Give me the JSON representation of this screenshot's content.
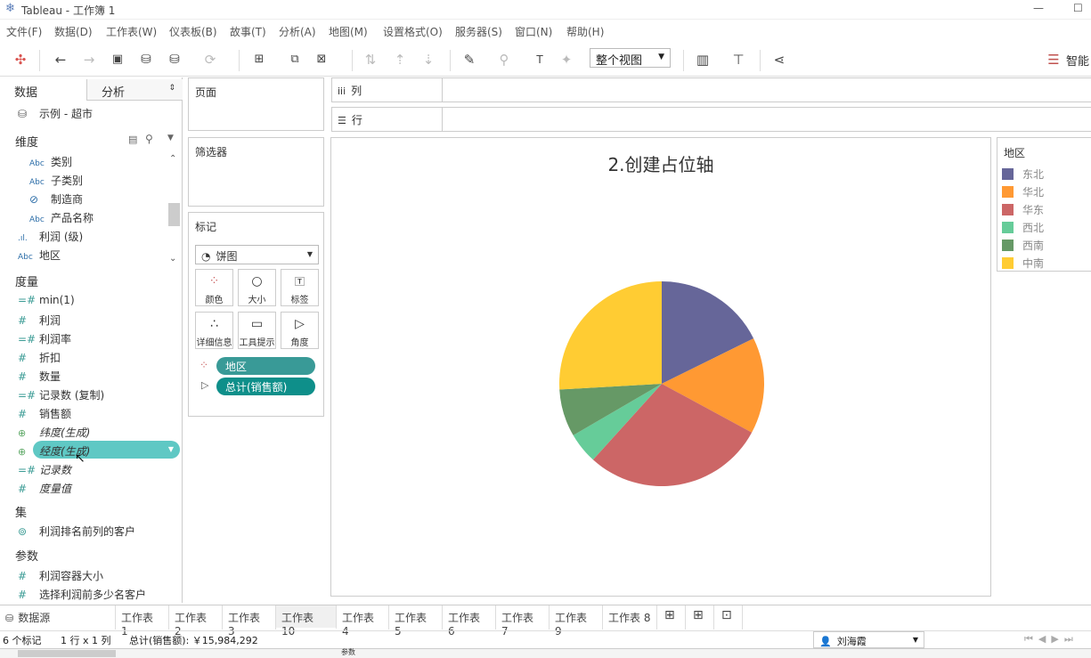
{
  "window": {
    "app_title": "Tableau - 工作簿 1"
  },
  "menu": [
    "文件(F)",
    "数据(D)",
    "工作表(W)",
    "仪表板(B)",
    "故事(T)",
    "分析(A)",
    "地图(M)",
    "设置格式(O)",
    "服务器(S)",
    "窗口(N)",
    "帮助(H)"
  ],
  "toolbar": {
    "fit_label": "整个视图",
    "smart_label": "智能"
  },
  "datapane": {
    "tab_data": "数据",
    "tab_analysis": "分析",
    "datasource": "示例 - 超市",
    "dimensions_header": "维度",
    "dimensions": [
      {
        "icon": "Abc",
        "label": "类别"
      },
      {
        "icon": "Abc",
        "label": "子类别"
      },
      {
        "icon": "paperclip",
        "label": "制造商"
      },
      {
        "icon": "Abc",
        "label": "产品名称"
      },
      {
        "icon": "bin",
        "label": "利润 (级)"
      },
      {
        "icon": "Abc",
        "label": "地区"
      }
    ],
    "measures_header": "度量",
    "measures": [
      {
        "icon": "=#",
        "label": "min(1)"
      },
      {
        "icon": "#",
        "label": "利润"
      },
      {
        "icon": "=#",
        "label": "利润率"
      },
      {
        "icon": "#",
        "label": "折扣"
      },
      {
        "icon": "#",
        "label": "数量"
      },
      {
        "icon": "=#",
        "label": "记录数 (复制)"
      },
      {
        "icon": "#",
        "label": "销售额"
      },
      {
        "icon": "globe",
        "label": "纬度(生成)"
      },
      {
        "icon": "globe",
        "label": "经度(生成)"
      },
      {
        "icon": "=#",
        "label": "记录数"
      },
      {
        "icon": "#",
        "label": "度量值"
      }
    ],
    "sets_header": "集",
    "sets": [
      {
        "label": "利润排名前列的客户"
      }
    ],
    "params_header": "参数",
    "params": [
      {
        "label": "利润容器大小"
      },
      {
        "label": "选择利润前多少名客户"
      }
    ]
  },
  "pages_label": "页面",
  "filters_label": "筛选器",
  "marks": {
    "header": "标记",
    "type": "饼图",
    "buttons": [
      "颜色",
      "大小",
      "标签",
      "详细信息",
      "工具提示",
      "角度"
    ],
    "pills": [
      {
        "label": "地区"
      },
      {
        "label": "总计(销售额)"
      }
    ]
  },
  "columns_label": "列",
  "rows_label": "行",
  "view_title": "2.创建占位轴",
  "legend": {
    "title": "地区",
    "items": [
      {
        "label": "东北",
        "color": "#666699"
      },
      {
        "label": "华北",
        "color": "#ff9933"
      },
      {
        "label": "华东",
        "color": "#cc6666"
      },
      {
        "label": "西北",
        "color": "#66cc99"
      },
      {
        "label": "西南",
        "color": "#669966"
      },
      {
        "label": "中南",
        "color": "#ffcc33"
      }
    ]
  },
  "chart_data": {
    "type": "pie",
    "title": "2.创建占位轴",
    "labels": [
      "东北",
      "华北",
      "华东",
      "西北",
      "西南",
      "中南"
    ],
    "values": [
      17.7,
      15.2,
      28.8,
      4.9,
      7.5,
      25.9
    ],
    "colors": [
      "#666699",
      "#ff9933",
      "#cc6666",
      "#66cc99",
      "#669966",
      "#ffcc33"
    ]
  },
  "sheet_tabs": [
    "数据源",
    "工作表 1",
    "工作表 2",
    "工作表 3",
    "工作表 10",
    "工作表 4",
    "工作表 5",
    "工作表 6",
    "工作表 7",
    "工作表 9",
    "工作表 8"
  ],
  "status": {
    "marks": "6 个标记",
    "shape": "1 行 x 1 列",
    "sum": "总计(销售额): ￥15,984,292",
    "user": "刘海霞",
    "bottom": "参数"
  }
}
